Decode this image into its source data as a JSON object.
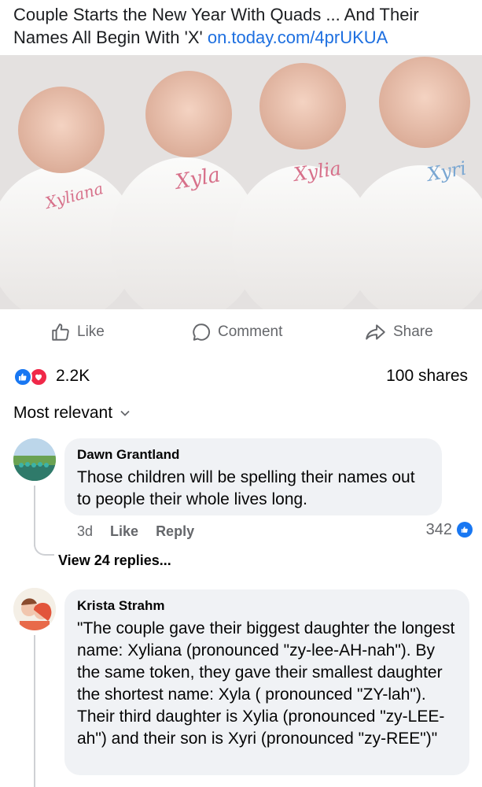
{
  "post": {
    "headline": "Couple Starts the New Year With Quads ... And Their Names All Begin With 'X'",
    "link_text": "on.today.com/4prUKUA",
    "photo_names": [
      "Xyliana",
      "Xyla",
      "Xylia",
      "Xyri"
    ]
  },
  "actions": {
    "like": "Like",
    "comment": "Comment",
    "share": "Share"
  },
  "stats": {
    "reactions": "2.2K",
    "shares": "100 shares"
  },
  "sort": {
    "label": "Most relevant"
  },
  "comments": [
    {
      "author": "Dawn Grantland",
      "text": "Those children will be spelling their names out to people their whole lives long.",
      "time": "3d",
      "like_label": "Like",
      "reply_label": "Reply",
      "reaction_count": "342",
      "view_replies": "View 24 replies..."
    },
    {
      "author": "Krista Strahm",
      "text": "\"The couple gave their biggest daughter the longest name: Xyliana (pronounced \"zy-lee-AH-nah\"). By the same token, they gave their smallest daughter the shortest name: Xyla ( pronounced \"ZY-lah\"). Their third daughter is Xylia (pronounced \"zy-LEE-ah\") and their son is Xyri (pronounced \"zy-REE\")\""
    }
  ],
  "colors": {
    "link": "#1d6fe0",
    "like_blue": "#1877f2",
    "love_red": "#f02849",
    "bubble": "#f0f2f5",
    "muted": "#65676b"
  }
}
